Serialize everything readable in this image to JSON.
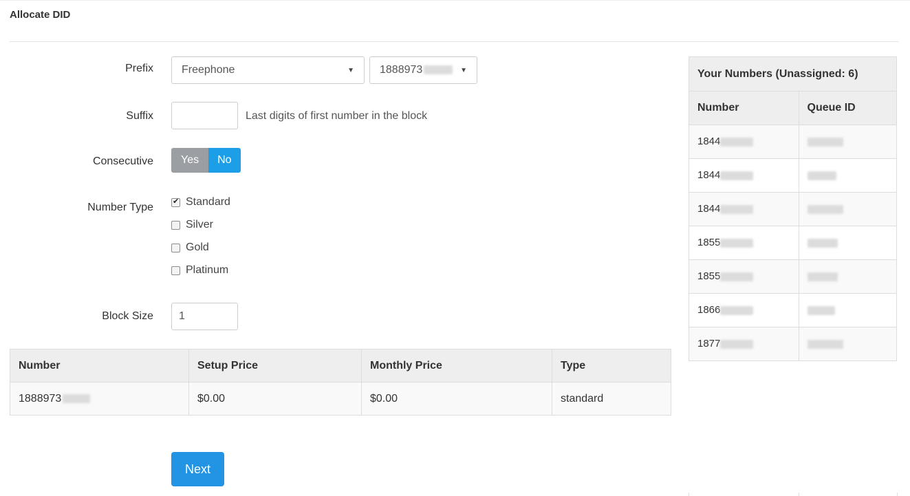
{
  "page": {
    "title": "Allocate DID"
  },
  "form": {
    "prefix": {
      "label": "Prefix",
      "type_value": "Freephone",
      "number_value": "1888973"
    },
    "suffix": {
      "label": "Suffix",
      "value": "",
      "help": "Last digits of first number in the block"
    },
    "consecutive": {
      "label": "Consecutive",
      "yes_label": "Yes",
      "no_label": "No",
      "selected": "No"
    },
    "number_type": {
      "label": "Number Type",
      "options": [
        {
          "label": "Standard",
          "checked": true
        },
        {
          "label": "Silver",
          "checked": false
        },
        {
          "label": "Gold",
          "checked": false
        },
        {
          "label": "Platinum",
          "checked": false
        }
      ]
    },
    "block_size": {
      "label": "Block Size",
      "value": "1"
    }
  },
  "results_table": {
    "headers": [
      "Number",
      "Setup Price",
      "Monthly Price",
      "Type"
    ],
    "rows": [
      {
        "number": "1888973",
        "setup_price": "$0.00",
        "monthly_price": "$0.00",
        "type": "standard"
      }
    ]
  },
  "your_numbers": {
    "caption": "Your Numbers (Unassigned: 6)",
    "headers": [
      "Number",
      "Queue ID"
    ],
    "rows": [
      {
        "number": "1844"
      },
      {
        "number": "1844"
      },
      {
        "number": "1844"
      },
      {
        "number": "1855"
      },
      {
        "number": "1855"
      },
      {
        "number": "1866"
      },
      {
        "number": "1877"
      }
    ]
  },
  "actions": {
    "next_label": "Next"
  },
  "colors": {
    "primary": "#2393e3",
    "toggle_active": "#1d9fe8",
    "toggle_inactive": "#9b9fa3"
  }
}
